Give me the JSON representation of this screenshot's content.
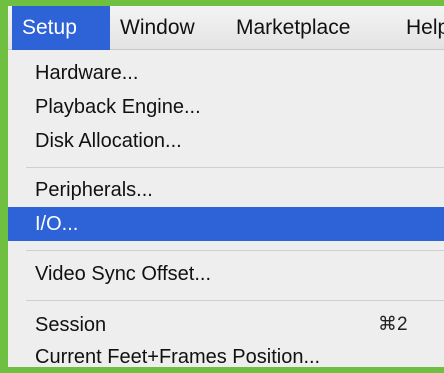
{
  "menubar": {
    "items": [
      {
        "label": "Setup",
        "active": true
      },
      {
        "label": "Window",
        "active": false
      },
      {
        "label": "Marketplace",
        "active": false
      },
      {
        "label": "Help",
        "active": false
      }
    ]
  },
  "setup_menu": {
    "items": [
      {
        "label": "Hardware..."
      },
      {
        "label": "Playback Engine..."
      },
      {
        "label": "Disk Allocation..."
      },
      {
        "label": "Peripherals..."
      },
      {
        "label": "I/O...",
        "highlighted": true
      },
      {
        "label": "Video Sync Offset..."
      },
      {
        "label": "Session",
        "shortcut": "⌘2"
      },
      {
        "label": "Current Feet+Frames Position..."
      }
    ]
  },
  "colors": {
    "highlight": "#2e63d8",
    "frame_border": "#6fc040",
    "menu_background": "#eeeeee"
  }
}
